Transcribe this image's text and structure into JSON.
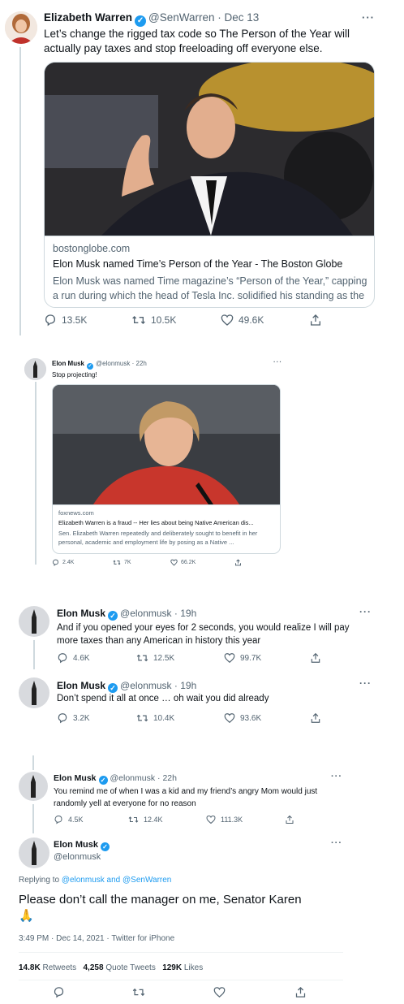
{
  "tweet1": {
    "name": "Elizabeth Warren",
    "handle": "@SenWarren",
    "date": "· Dec 13",
    "text": "Let’s change the rigged tax code so The Person of the Year will actually pay taxes and stop freeloading off everyone else.",
    "card": {
      "domain": "bostonglobe.com",
      "title": "Elon Musk named Time’s Person of the Year - The Boston Globe",
      "desc": "Elon Musk was named Time magazine’s “Person of the Year,” capping a run during which the head of Tesla Inc. solidified his standing as the ..."
    },
    "replies": "13.5K",
    "retweets": "10.5K",
    "likes": "49.6K"
  },
  "tweet2": {
    "name": "Elon Musk",
    "handle": "@elonmusk",
    "date": "· 22h",
    "text": "Stop projecting!",
    "card": {
      "domain": "foxnews.com",
      "title": "Elizabeth Warren is a fraud -- Her lies about being Native American dis...",
      "desc": "Sen. Elizabeth Warren repeatedly and deliberately sought to benefit in her personal, academic and employment life by posing as a Native ..."
    },
    "replies": "2.4K",
    "retweets": "7K",
    "likes": "66.2K"
  },
  "tweet3": {
    "name": "Elon Musk",
    "handle": "@elonmusk",
    "date": "· 19h",
    "text": "And if you opened your eyes for 2 seconds, you would realize I will pay more taxes than any American in history this year",
    "replies": "4.6K",
    "retweets": "12.5K",
    "likes": "99.7K"
  },
  "tweet4": {
    "name": "Elon Musk",
    "handle": "@elonmusk",
    "date": "· 19h",
    "text": "Don’t spend it all at once … oh wait you did already",
    "replies": "3.2K",
    "retweets": "10.4K",
    "likes": "93.6K"
  },
  "tweet5": {
    "name": "Elon Musk",
    "handle": "@elonmusk",
    "date": "· 22h",
    "text": "You remind me of when I was a kid and my friend’s angry Mom would just randomly yell at everyone for no reason",
    "replies": "4.5K",
    "retweets": "12.4K",
    "likes": "111.3K"
  },
  "main": {
    "name": "Elon Musk",
    "handle": "@elonmusk",
    "replying_prefix": "Replying to ",
    "replying_to": "@elonmusk and @SenWarren",
    "text": "Please don’t call the manager on me, Senator Karen",
    "emoji": "🙏",
    "timestamp": "3:49 PM · Dec 14, 2021 · Twitter for iPhone",
    "retweets_count": "14.8K",
    "retweets_label": "Retweets",
    "quotes_count": "4,258",
    "quotes_label": "Quote Tweets",
    "likes_count": "129K",
    "likes_label": "Likes"
  },
  "more_glyph": "···",
  "colors": {
    "blue": "#1d9bf0",
    "text": "#0f1419",
    "muted": "#536471",
    "border": "#cfd9de"
  }
}
